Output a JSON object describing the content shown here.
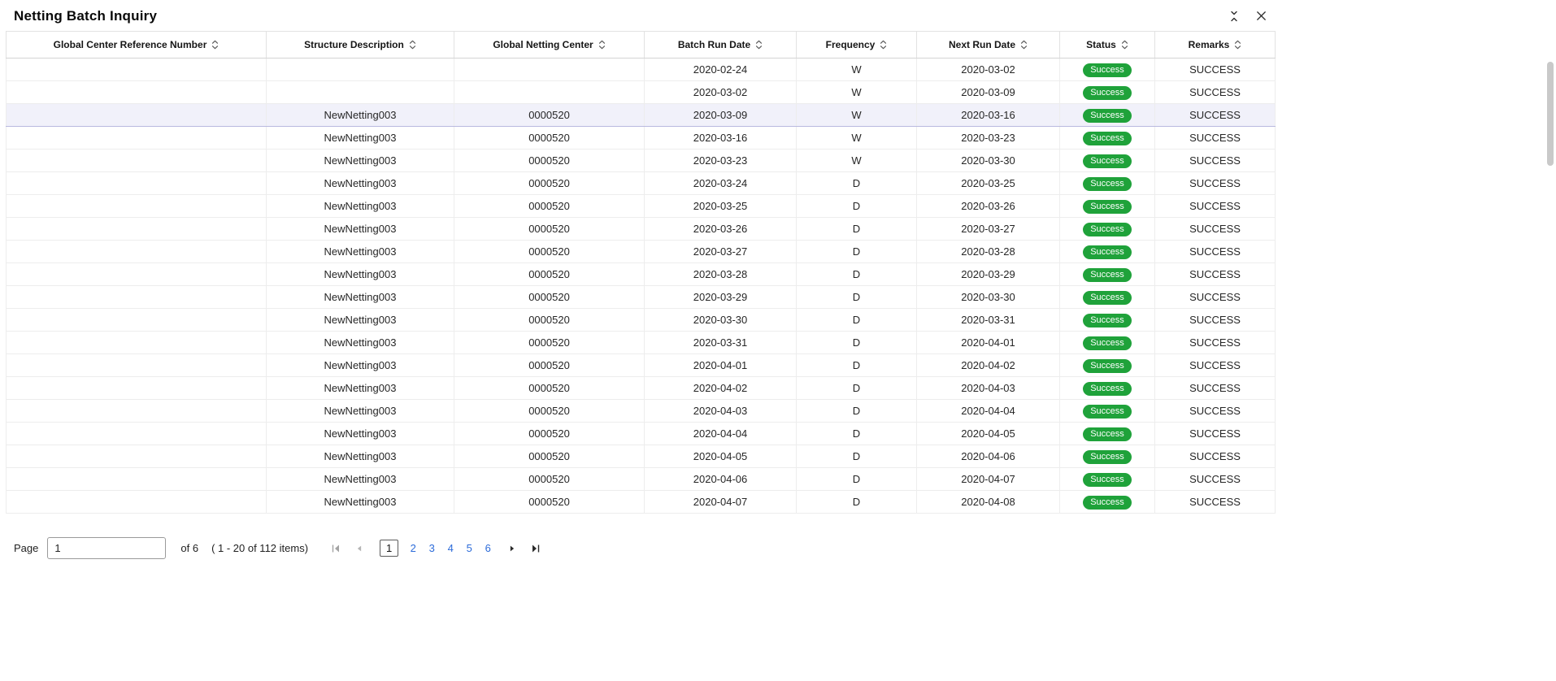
{
  "header": {
    "title": "Netting Batch Inquiry"
  },
  "table": {
    "columns": [
      "Global Center Reference Number",
      "Structure Description",
      "Global Netting Center",
      "Batch Run Date",
      "Frequency",
      "Next Run Date",
      "Status",
      "Remarks"
    ],
    "selected_row_index": 2,
    "rows": [
      [
        "",
        "",
        "",
        "2020-02-24",
        "W",
        "2020-03-02",
        "Success",
        "SUCCESS"
      ],
      [
        "",
        "",
        "",
        "2020-03-02",
        "W",
        "2020-03-09",
        "Success",
        "SUCCESS"
      ],
      [
        "",
        "NewNetting003",
        "0000520",
        "2020-03-09",
        "W",
        "2020-03-16",
        "Success",
        "SUCCESS"
      ],
      [
        "",
        "NewNetting003",
        "0000520",
        "2020-03-16",
        "W",
        "2020-03-23",
        "Success",
        "SUCCESS"
      ],
      [
        "",
        "NewNetting003",
        "0000520",
        "2020-03-23",
        "W",
        "2020-03-30",
        "Success",
        "SUCCESS"
      ],
      [
        "",
        "NewNetting003",
        "0000520",
        "2020-03-24",
        "D",
        "2020-03-25",
        "Success",
        "SUCCESS"
      ],
      [
        "",
        "NewNetting003",
        "0000520",
        "2020-03-25",
        "D",
        "2020-03-26",
        "Success",
        "SUCCESS"
      ],
      [
        "",
        "NewNetting003",
        "0000520",
        "2020-03-26",
        "D",
        "2020-03-27",
        "Success",
        "SUCCESS"
      ],
      [
        "",
        "NewNetting003",
        "0000520",
        "2020-03-27",
        "D",
        "2020-03-28",
        "Success",
        "SUCCESS"
      ],
      [
        "",
        "NewNetting003",
        "0000520",
        "2020-03-28",
        "D",
        "2020-03-29",
        "Success",
        "SUCCESS"
      ],
      [
        "",
        "NewNetting003",
        "0000520",
        "2020-03-29",
        "D",
        "2020-03-30",
        "Success",
        "SUCCESS"
      ],
      [
        "",
        "NewNetting003",
        "0000520",
        "2020-03-30",
        "D",
        "2020-03-31",
        "Success",
        "SUCCESS"
      ],
      [
        "",
        "NewNetting003",
        "0000520",
        "2020-03-31",
        "D",
        "2020-04-01",
        "Success",
        "SUCCESS"
      ],
      [
        "",
        "NewNetting003",
        "0000520",
        "2020-04-01",
        "D",
        "2020-04-02",
        "Success",
        "SUCCESS"
      ],
      [
        "",
        "NewNetting003",
        "0000520",
        "2020-04-02",
        "D",
        "2020-04-03",
        "Success",
        "SUCCESS"
      ],
      [
        "",
        "NewNetting003",
        "0000520",
        "2020-04-03",
        "D",
        "2020-04-04",
        "Success",
        "SUCCESS"
      ],
      [
        "",
        "NewNetting003",
        "0000520",
        "2020-04-04",
        "D",
        "2020-04-05",
        "Success",
        "SUCCESS"
      ],
      [
        "",
        "NewNetting003",
        "0000520",
        "2020-04-05",
        "D",
        "2020-04-06",
        "Success",
        "SUCCESS"
      ],
      [
        "",
        "NewNetting003",
        "0000520",
        "2020-04-06",
        "D",
        "2020-04-07",
        "Success",
        "SUCCESS"
      ],
      [
        "",
        "NewNetting003",
        "0000520",
        "2020-04-07",
        "D",
        "2020-04-08",
        "Success",
        "SUCCESS"
      ]
    ]
  },
  "pagination": {
    "page_label": "Page",
    "page_value": "1",
    "of_label": "of 6",
    "items_label": "( 1 - 20 of 112 items)",
    "pages": [
      "1",
      "2",
      "3",
      "4",
      "5",
      "6"
    ],
    "current_page": "1"
  },
  "colors": {
    "success_green": "#1FA23A",
    "link_blue": "#2C6BD9",
    "selected_row_bg": "#F1F1FA",
    "selected_row_border": "#B9B9DF"
  }
}
